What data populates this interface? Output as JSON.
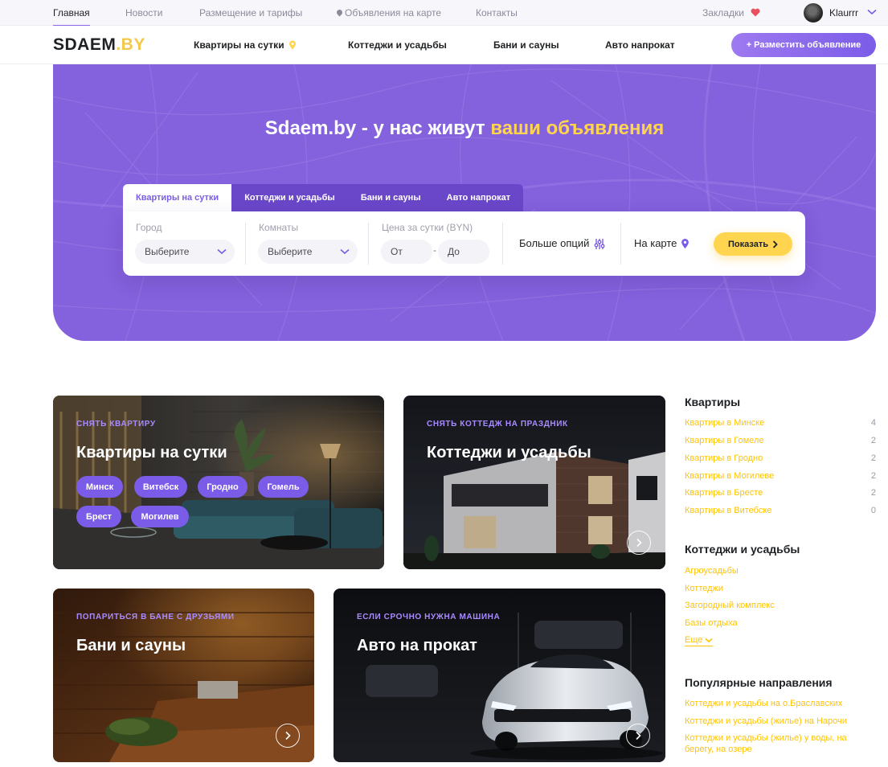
{
  "topbar": {
    "nav": [
      "Главная",
      "Новости",
      "Размещение и тарифы",
      "Объявления на карте",
      "Контакты"
    ],
    "bookmarks": "Закладки",
    "username": "Klaurrr"
  },
  "header": {
    "logo_main": "SDAEM",
    "logo_dot": ".BY",
    "nav": [
      "Квартиры на сутки",
      "Коттеджи и усадьбы",
      "Бани и сауны",
      "Авто напрокат"
    ],
    "post_button": "+ Разместить объявление"
  },
  "hero": {
    "title_start": "Sdaem.by - у нас живут ",
    "title_accent": "ваши объявления",
    "tabs": [
      "Квартиры на сутки",
      "Коттеджи и усадьбы",
      "Бани и сауны",
      "Авто напрокат"
    ],
    "search": {
      "city_label": "Город",
      "city_value": "Выберите",
      "rooms_label": "Комнаты",
      "rooms_value": "Выберите",
      "price_label": "Цена за сутки (BYN)",
      "price_from": "От",
      "price_dash": "-",
      "price_to": "До",
      "more_options": "Больше опций",
      "on_map": "На карте",
      "show_button": "Показать"
    }
  },
  "cards": {
    "apartments": {
      "kicker": "СНЯТЬ КВАРТИРУ",
      "title": "Квартиры на сутки",
      "cities": [
        "Минск",
        "Витебск",
        "Гродно",
        "Гомель",
        "Брест",
        "Могилев"
      ]
    },
    "cottages": {
      "kicker": "СНЯТЬ КОТТЕДЖ НА ПРАЗДНИК",
      "title": "Коттеджи и усадьбы"
    },
    "saunas": {
      "kicker": "ПОПАРИТЬСЯ В БАНЕ С ДРУЗЬЯМИ",
      "title": "Бани и сауны"
    },
    "cars": {
      "kicker": "ЕСЛИ СРОЧНО НУЖНА МАШИНА",
      "title": "Авто на прокат"
    }
  },
  "sidebar": {
    "apartments_title": "Квартиры",
    "apartments": [
      {
        "label": "Квартиры в Минске",
        "count": "4"
      },
      {
        "label": "Квартиры в Гомеле",
        "count": "2"
      },
      {
        "label": "Квартиры в Гродно",
        "count": "2"
      },
      {
        "label": "Квартиры в Могилеве",
        "count": "2"
      },
      {
        "label": "Квартиры в Бресте",
        "count": "2"
      },
      {
        "label": "Квартиры в Витебске",
        "count": "0"
      }
    ],
    "cottages_title": "Коттеджи и усадьбы",
    "cottages": [
      "Агроусадьбы",
      "Коттеджи",
      "Загородный комплекс",
      "Базы отдыха"
    ],
    "more": "Еще",
    "popular_title": "Популярные направления",
    "popular": [
      "Коттеджи и усадьбы на о.Браславских",
      "Коттеджи и усадьбы (жилье) на Нарочи",
      "Коттеджи и усадьбы (жилье) у воды, на",
      "берегу, на озере"
    ]
  },
  "colors": {
    "brand_purple": "#7b5ce8",
    "hero_bg": "#8461dd",
    "accent_yellow": "#ffd54f",
    "link_yellow": "#ffc400"
  },
  "icons": [
    "map-pin-icon",
    "heart-icon",
    "chevron-down-icon",
    "sliders-icon",
    "chevron-right-icon",
    "arrow-right-icon"
  ]
}
